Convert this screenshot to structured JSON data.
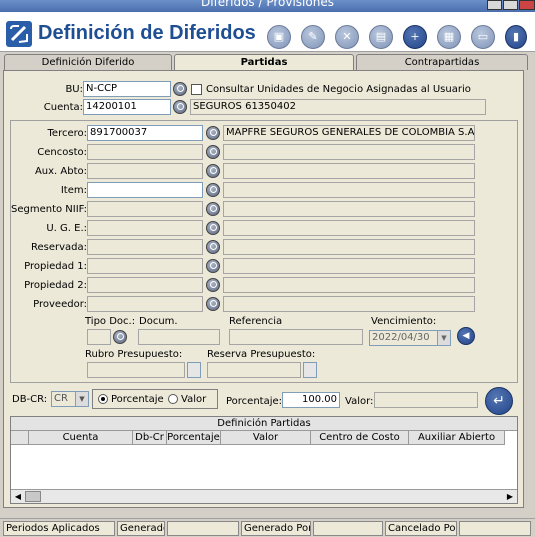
{
  "window": {
    "title": "Diferidos / Provisiones"
  },
  "app": {
    "title": "Definición de Diferidos"
  },
  "tabs": [
    {
      "label": "Definición Diferido"
    },
    {
      "label": "Partidas"
    },
    {
      "label": "Contrapartidas"
    }
  ],
  "form": {
    "bu_label": "BU:",
    "bu_value": "N-CCP",
    "consult_label": "Consultar Unidades de Negocio Asignadas al Usuario",
    "cuenta_label": "Cuenta:",
    "cuenta_value": "14200101",
    "cuenta_desc": "SEGUROS 61350402",
    "tercero_label": "Tercero:",
    "tercero_value": "891700037",
    "tercero_desc": "MAPFRE SEGUROS GENERALES DE COLOMBIA S.A",
    "cencosto_label": "Cencosto:",
    "aux_label": "Aux. Abto:",
    "item_label": "Item:",
    "niif_label": "Segmento NIIF:",
    "uge_label": "U. G. E.:",
    "reservada_label": "Reservada:",
    "prop1_label": "Propiedad 1:",
    "prop2_label": "Propiedad 2:",
    "proveedor_label": "Proveedor:",
    "tipodoc_label": "Tipo Doc.:",
    "docum_label": "Docum.",
    "referencia_label": "Referencia",
    "vencimiento_label": "Vencimiento:",
    "vencimiento_value": "2022/04/30",
    "rubro_label": "Rubro Presupuesto:",
    "reserva_label": "Reserva Presupuesto:",
    "dbcr_label": "DB-CR:",
    "dbcr_value": "CR",
    "porcentaje_radio": "Porcentaje",
    "valor_radio": "Valor",
    "porcentaje_label": "Porcentaje:",
    "porcentaje_value": "100.00",
    "valor_label": "Valor:"
  },
  "grid": {
    "title": "Definición Partidas",
    "columns": [
      "Cuenta",
      "Db-Cr",
      "Porcentaje",
      "Valor",
      "Centro de Costo",
      "Auxiliar Abierto"
    ]
  },
  "status": {
    "items": [
      "Periodos Aplicados",
      "Generado",
      "Generado Por",
      "Cancelado Por"
    ]
  }
}
